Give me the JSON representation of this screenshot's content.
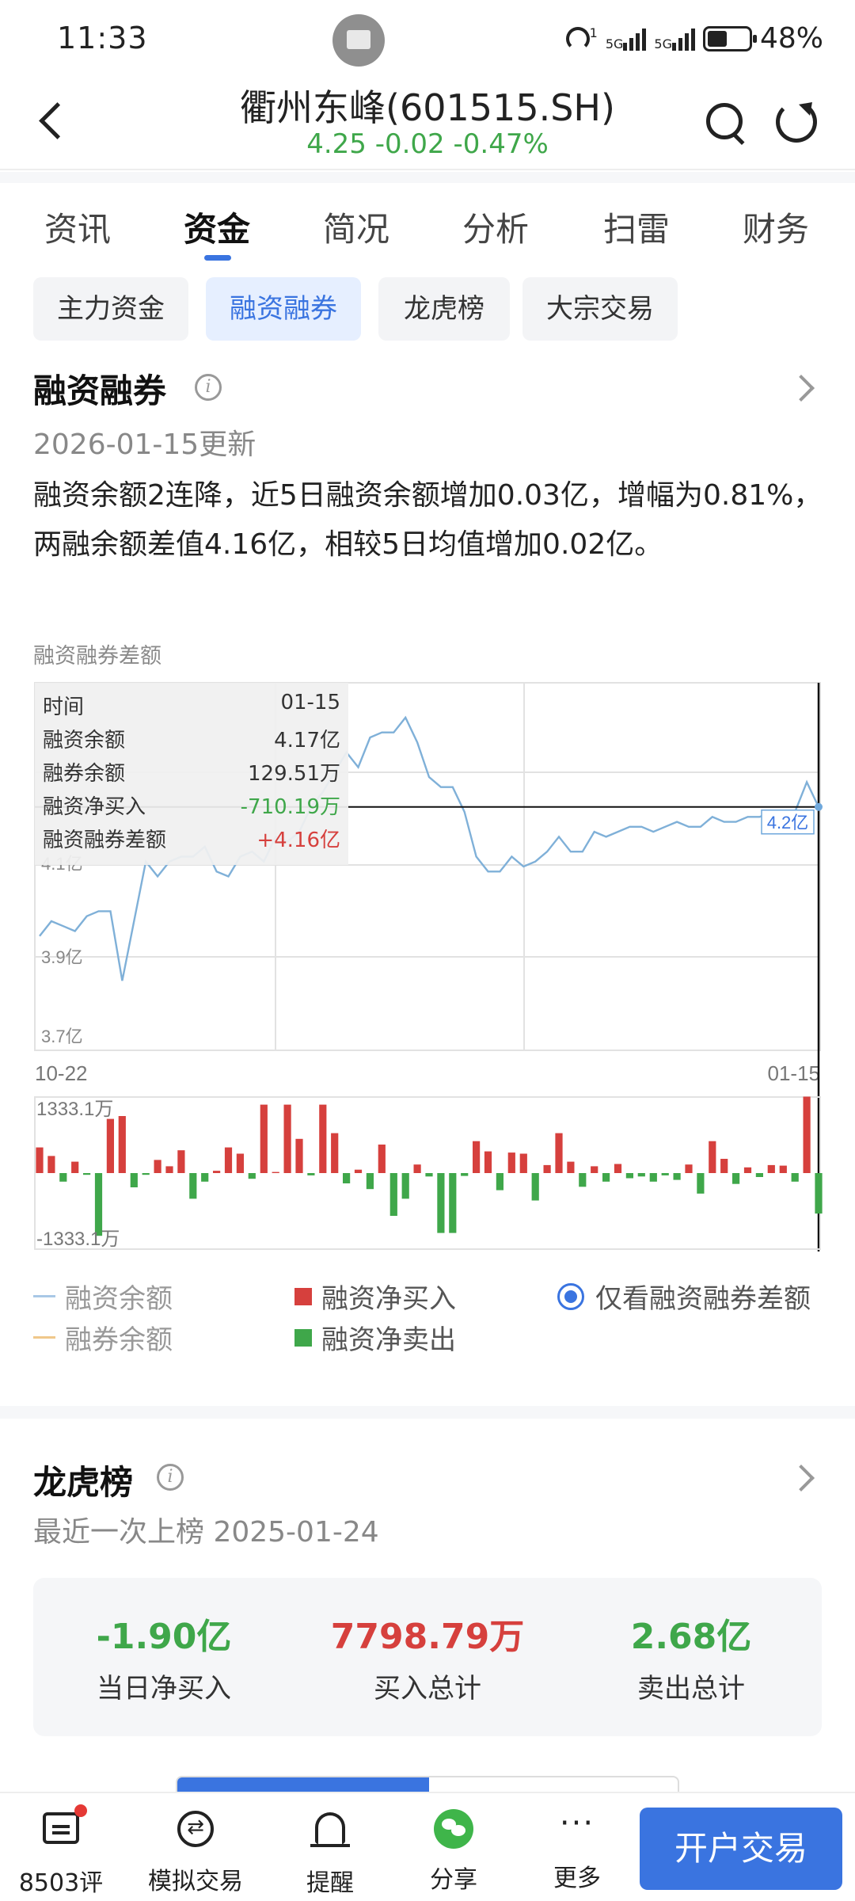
{
  "status_bar": {
    "time": "11:33",
    "battery": "48%",
    "net1": "5G",
    "net2": "5G",
    "hotspot_badge": "1"
  },
  "header": {
    "title": "衢州东峰(601515.SH)",
    "quote": "4.25 -0.02 -0.47%",
    "quote_color": "#3fa74a"
  },
  "tabs": [
    {
      "label": "资讯"
    },
    {
      "label": "资金",
      "active": true
    },
    {
      "label": "简况"
    },
    {
      "label": "分析"
    },
    {
      "label": "扫雷"
    },
    {
      "label": "财务"
    }
  ],
  "subtabs": [
    {
      "label": "主力资金"
    },
    {
      "label": "融资融券",
      "active": true
    },
    {
      "label": "龙虎榜"
    },
    {
      "label": "大宗交易"
    }
  ],
  "margin_section": {
    "title": "融资融券",
    "updated": "2026-01-15更新",
    "description": "融资余额2连降，近5日融资余额增加0.03亿，增幅为0.81%，两融余额差值4.16亿，相较5日均值增加0.02亿。",
    "chart_caption": "融资融券差额",
    "tooltip": {
      "rows": [
        {
          "key": "时间",
          "value": "01-15"
        },
        {
          "key": "融资余额",
          "value": "4.17亿"
        },
        {
          "key": "融券余额",
          "value": "129.51万"
        },
        {
          "key": "融资净买入",
          "value": "-710.19万"
        },
        {
          "key": "融资融券差额",
          "value": "+4.16亿"
        }
      ]
    },
    "crosshair_label": "4.2亿",
    "legend": {
      "line1": "融资余额",
      "line2": "融券余额",
      "bar_up": "融资净买入",
      "bar_down": "融资净卖出",
      "radio": "仅看融资融券差额"
    }
  },
  "chart_data": [
    {
      "type": "line",
      "y_tick_labels": [
        "4.1亿",
        "3.9亿",
        "3.7亿"
      ],
      "x_tick_labels": [
        "10-22",
        "01-15"
      ],
      "ylim": [
        3.68,
        4.42
      ],
      "grid": true,
      "series": [
        {
          "name": "融资余额",
          "color": "#7fb0d8",
          "values": [
            3.91,
            3.94,
            3.93,
            3.92,
            3.95,
            3.96,
            3.96,
            3.82,
            3.94,
            4.06,
            4.03,
            4.06,
            4.07,
            4.07,
            4.09,
            4.04,
            4.03,
            4.07,
            4.08,
            4.06,
            4.11,
            4.1,
            4.12,
            4.17,
            4.2,
            4.24,
            4.28,
            4.25,
            4.31,
            4.32,
            4.32,
            4.35,
            4.3,
            4.23,
            4.21,
            4.21,
            4.16,
            4.07,
            4.04,
            4.04,
            4.07,
            4.05,
            4.06,
            4.08,
            4.11,
            4.08,
            4.08,
            4.12,
            4.11,
            4.12,
            4.13,
            4.13,
            4.12,
            4.13,
            4.14,
            4.13,
            4.13,
            4.15,
            4.14,
            4.14,
            4.15,
            4.15,
            4.16,
            4.15,
            4.16,
            4.22,
            4.17
          ]
        }
      ]
    },
    {
      "type": "bar",
      "y_tick_labels": [
        "1333.1万",
        "-1333.1万"
      ],
      "ylim": [
        -1333.1,
        1333.1
      ],
      "up_color": "#d6403d",
      "down_color": "#3fa74a",
      "series": [
        {
          "name": "融资净买入/卖出",
          "values": [
            450,
            300,
            -150,
            200,
            -30,
            -1100,
            950,
            1000,
            -250,
            -30,
            230,
            120,
            400,
            -450,
            -150,
            40,
            450,
            340,
            -100,
            1200,
            20,
            1200,
            600,
            -40,
            1200,
            700,
            -180,
            60,
            -280,
            500,
            -750,
            -450,
            150,
            -60,
            -1050,
            -1050,
            -50,
            560,
            380,
            -300,
            360,
            340,
            -480,
            140,
            700,
            200,
            -240,
            120,
            -150,
            160,
            -90,
            -60,
            -150,
            -40,
            -120,
            150,
            -360,
            560,
            250,
            -190,
            100,
            -70,
            140,
            130,
            -150,
            1340,
            -710
          ]
        }
      ]
    }
  ],
  "lhb_section": {
    "title": "龙虎榜",
    "subtitle": "最近一次上榜 2025-01-24",
    "stats": [
      {
        "value": "-1.90亿",
        "label": "当日净买入"
      },
      {
        "value": "7798.79万",
        "label": "买入总计"
      },
      {
        "value": "2.68亿",
        "label": "卖出总计"
      }
    ]
  },
  "bottom_nav": {
    "comments": "8503评",
    "sim_trade": "模拟交易",
    "alert": "提醒",
    "share": "分享",
    "more": "更多",
    "more_glyph": "···",
    "open_account": "开户交易"
  }
}
